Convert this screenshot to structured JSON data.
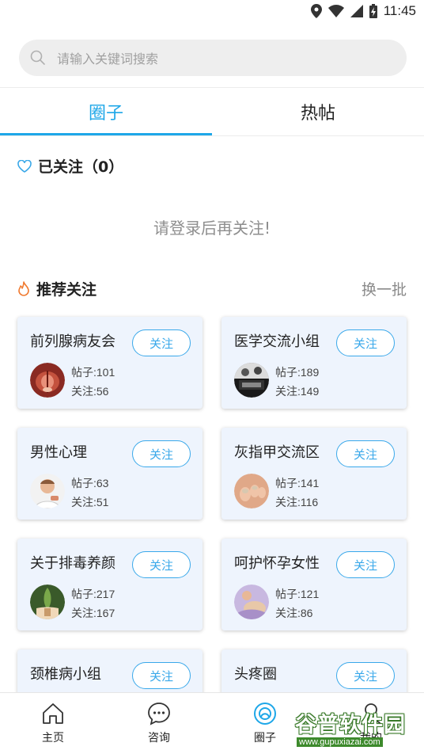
{
  "status_bar": {
    "time": "11:45",
    "icons": [
      "location-icon",
      "wifi-icon",
      "signal-icon",
      "battery-icon"
    ]
  },
  "search": {
    "placeholder": "请输入关键词搜索"
  },
  "tabs": [
    {
      "label": "圈子",
      "active": true
    },
    {
      "label": "热帖",
      "active": false
    }
  ],
  "followed": {
    "title": "已关注（0）",
    "login_tip": "请登录后再关注!"
  },
  "recommend": {
    "title": "推荐关注",
    "refresh_label": "换一批"
  },
  "groups": [
    {
      "name": "前列腺病友会",
      "button": "关注",
      "posts": "帖子:101",
      "followers": "关注:56",
      "avatar": "prostate-avatar"
    },
    {
      "name": "医学交流小组",
      "button": "关注",
      "posts": "帖子:189",
      "followers": "关注:149",
      "avatar": "medical-group-avatar"
    },
    {
      "name": "男性心理",
      "button": "关注",
      "posts": "帖子:63",
      "followers": "关注:51",
      "avatar": "male-psychology-avatar"
    },
    {
      "name": "灰指甲交流区",
      "button": "关注",
      "posts": "帖子:141",
      "followers": "关注:116",
      "avatar": "nail-avatar"
    },
    {
      "name": "关于排毒养颜",
      "button": "关注",
      "posts": "帖子:217",
      "followers": "关注:167",
      "avatar": "detox-avatar"
    },
    {
      "name": "呵护怀孕女性",
      "button": "关注",
      "posts": "帖子:121",
      "followers": "关注:86",
      "avatar": "pregnancy-avatar"
    },
    {
      "name": "颈椎病小组",
      "button": "关注",
      "posts": "",
      "followers": "",
      "avatar": ""
    },
    {
      "name": "头疼圈",
      "button": "关注",
      "posts": "",
      "followers": "",
      "avatar": ""
    }
  ],
  "bottom_nav": [
    {
      "label": "主页",
      "icon": "home-icon",
      "active": false
    },
    {
      "label": "咨询",
      "icon": "chat-icon",
      "active": false
    },
    {
      "label": "圈子",
      "icon": "circle-icon",
      "active": true
    },
    {
      "label": "我的",
      "icon": "profile-icon",
      "active": false
    }
  ],
  "watermark": {
    "big": "谷普软件园",
    "small": "www.gupuxiazai.com"
  },
  "colors": {
    "accent": "#1ea7e8",
    "button_border": "#39a8ea",
    "card_bg": "#eef4fd",
    "refresh": "#8a8a8a",
    "fire": "#f07a30",
    "heart": "#3aa8e8"
  }
}
